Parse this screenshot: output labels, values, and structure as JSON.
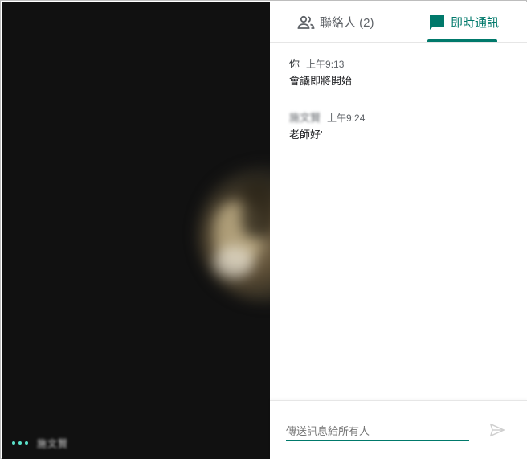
{
  "tabs": {
    "people": {
      "label": "聯絡人 (2)",
      "icon": "people-icon"
    },
    "chat": {
      "label": "即時通訊",
      "icon": "chat-bubble-icon",
      "active": true
    }
  },
  "messages": [
    {
      "sender": "你",
      "time": "上午9:13",
      "text": "會議即將開始"
    },
    {
      "sender": "施文賢",
      "time": "上午9:24",
      "text": "老師好'"
    }
  ],
  "compose": {
    "placeholder": "傳送訊息給所有人",
    "send_icon": "send-icon"
  },
  "stage": {
    "participant_name": "施文賢",
    "menu_icon": "more-dots-icon"
  },
  "colors": {
    "accent": "#00796b",
    "stage_bg": "#111111",
    "dots": "#5be0c9"
  }
}
